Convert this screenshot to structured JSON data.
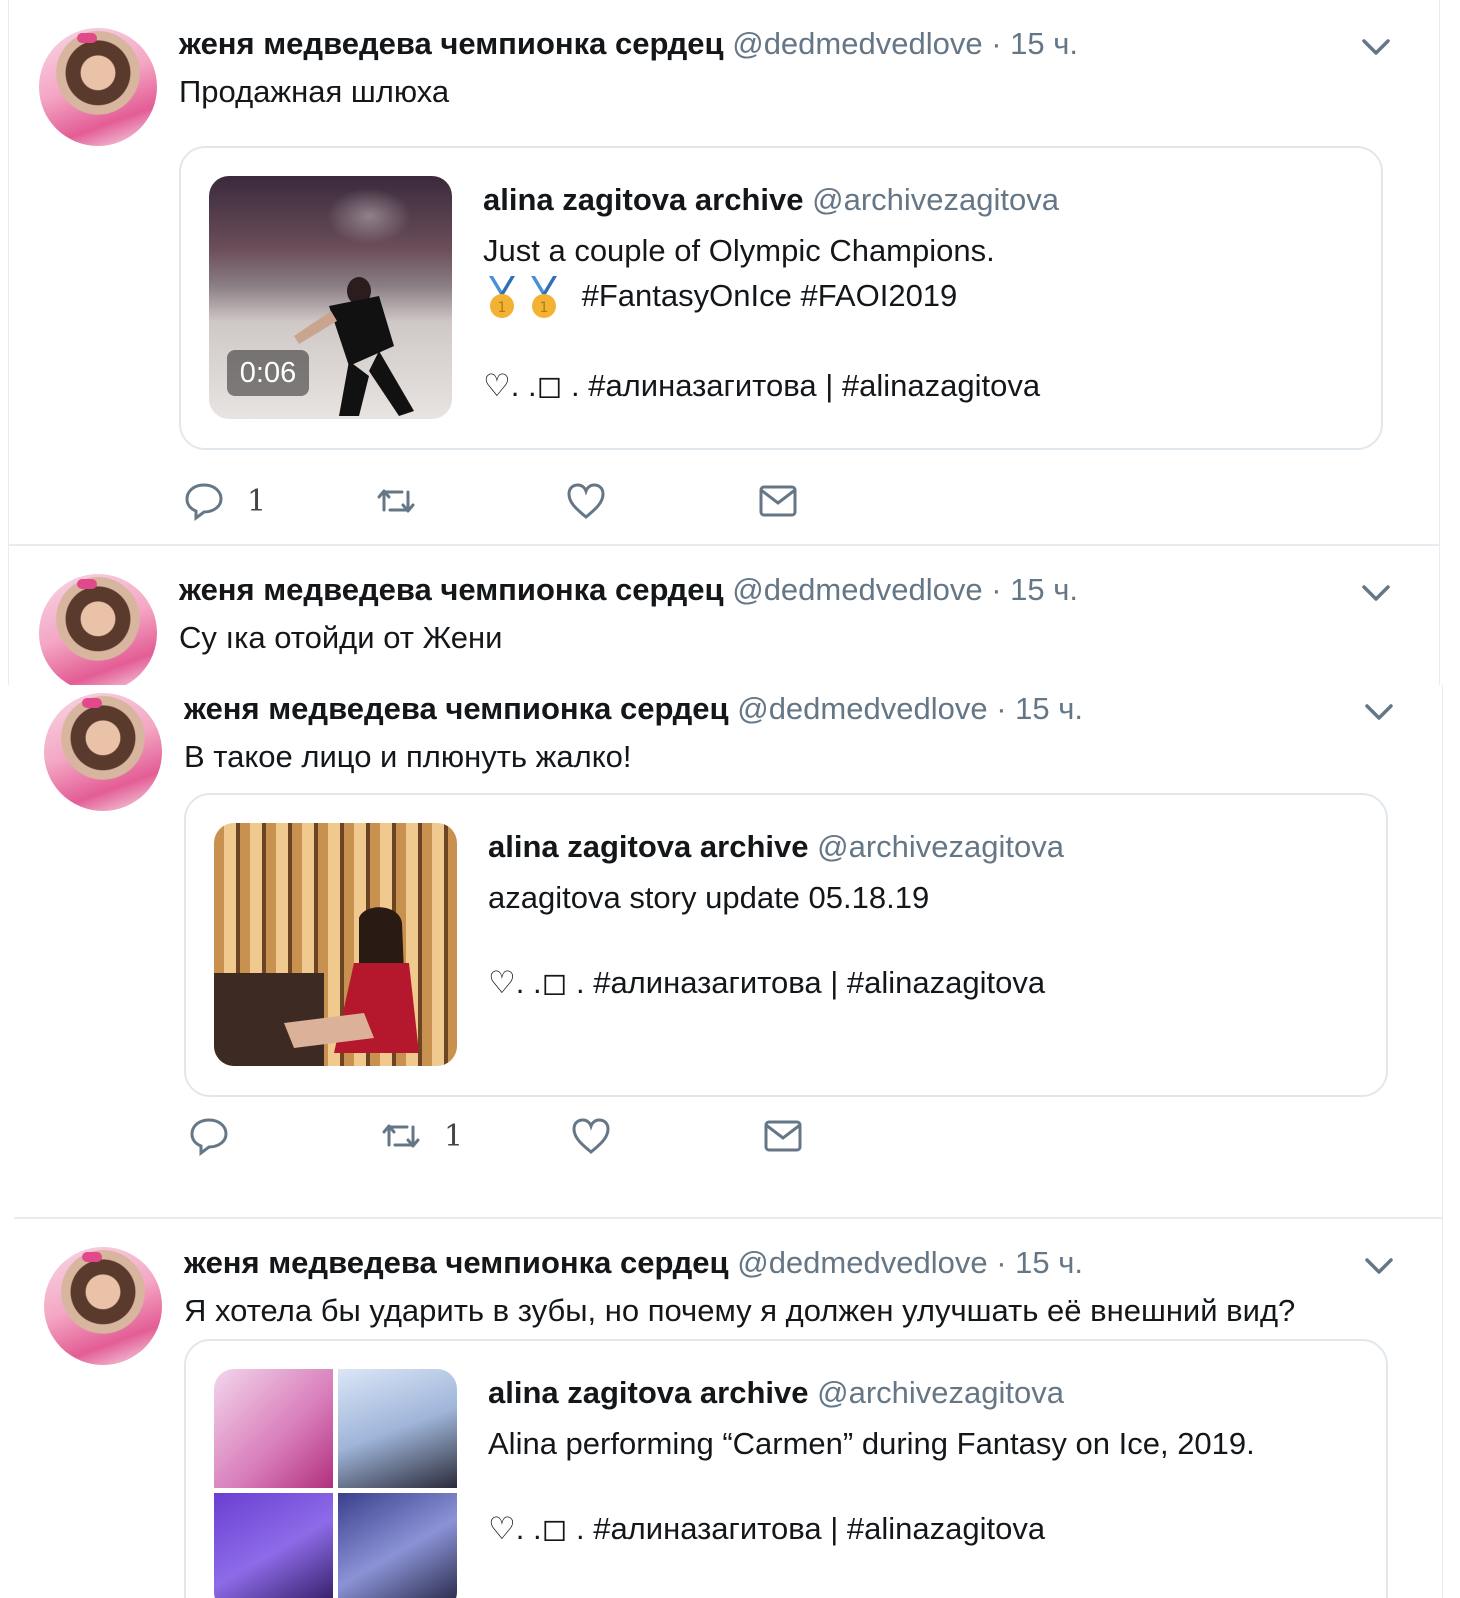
{
  "colors": {
    "text": "#14171a",
    "secondary": "#657786",
    "border": "#e1e8ed",
    "divider": "#e6ecf0"
  },
  "icons": [
    "chevron-down-icon",
    "reply-icon",
    "retweet-icon",
    "like-icon",
    "dm-icon",
    "medal-icon"
  ],
  "tweets": [
    {
      "display_name": "женя медведева чемпионка сердец",
      "handle": "@dedmedvedlove",
      "dot": " · ",
      "time": "15 ч.",
      "text": "Продажная шлюха",
      "card": {
        "name": "alina zagitova archive",
        "handle": "@archivezagitova",
        "line1": "Just a couple of Olympic Champions.",
        "line2": "#FantasyOnIce #FAOI2019",
        "tags": "♡. .◻ . #алиназагитова | #alinazagitova",
        "video_time": "0:06"
      },
      "actions": {
        "reply": "1",
        "retweet": "",
        "like": ""
      }
    },
    {
      "display_name": "женя медведева чемпионка сердец",
      "handle": "@dedmedvedlove",
      "dot": " · ",
      "time": "15 ч.",
      "text": "Су ıка отойди от Жени"
    },
    {
      "display_name": "женя медведева чемпионка сердец",
      "handle": "@dedmedvedlove",
      "dot": " · ",
      "time": "15 ч.",
      "text": "В такое лицо и плюнуть жалко!",
      "card": {
        "name": "alina zagitova archive",
        "handle": "@archivezagitova",
        "line1": "azagitova story update 05.18.19",
        "tags": "♡. .◻ . #алиназагитова | #alinazagitova"
      },
      "actions": {
        "reply": "",
        "retweet": "1",
        "like": ""
      }
    },
    {
      "display_name": "женя медведева чемпионка сердец",
      "handle": "@dedmedvedlove",
      "dot": " · ",
      "time": "15 ч.",
      "text": "Я хотела бы  ударить в зубы, но почему я должен улучшать её внешний вид?",
      "card": {
        "name": "alina zagitova archive",
        "handle": "@archivezagitova",
        "line1": "Alina performing “Carmen” during Fantasy on Ice, 2019.",
        "tags": "♡. .◻ . #алиназагитова | #alinazagitova"
      }
    }
  ]
}
